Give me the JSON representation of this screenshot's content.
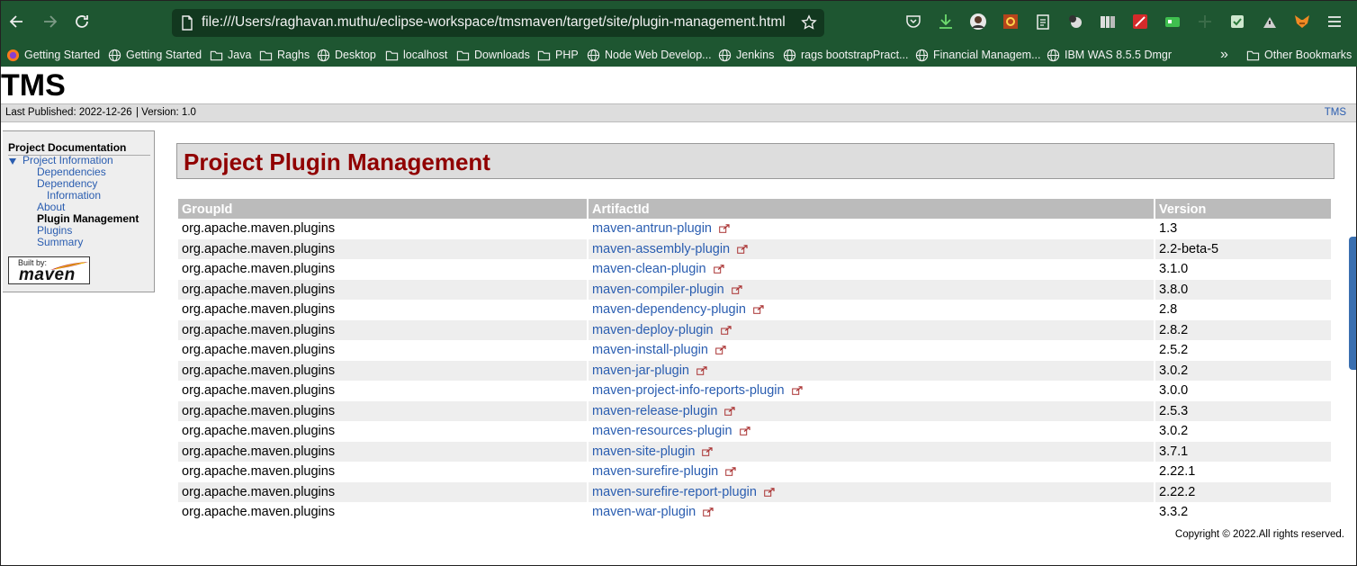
{
  "browser": {
    "url": "file:///Users/raghavan.muthu/eclipse-workspace/tmsmaven/target/site/plugin-management.html",
    "toolbar_icons": [
      "pocket-icon",
      "download-icon",
      "profile-avatar-icon",
      "extension-settings-icon",
      "clipboard-icon",
      "extension-ball-icon",
      "library-icon",
      "extension-red-icon",
      "extension-green-icon",
      "extension-gray-icon",
      "extension-save-icon",
      "extension-tool-icon",
      "metamask-fox-icon",
      "menu-icon"
    ],
    "bookmarks": [
      {
        "label": "Getting Started",
        "icon": "firefox-icon"
      },
      {
        "label": "Getting Started",
        "icon": "globe-icon"
      },
      {
        "label": "Java",
        "icon": "folder-icon"
      },
      {
        "label": "Raghs",
        "icon": "folder-icon"
      },
      {
        "label": "Desktop",
        "icon": "globe-icon"
      },
      {
        "label": "localhost",
        "icon": "folder-icon"
      },
      {
        "label": "Downloads",
        "icon": "folder-icon"
      },
      {
        "label": "PHP",
        "icon": "folder-icon"
      },
      {
        "label": "Node Web Develop...",
        "icon": "globe-icon"
      },
      {
        "label": "Jenkins",
        "icon": "globe-icon"
      },
      {
        "label": "rags bootstrapPract...",
        "icon": "globe-icon"
      },
      {
        "label": "Financial Managem...",
        "icon": "globe-icon"
      },
      {
        "label": "IBM WAS 8.5.5 Dmgr",
        "icon": "globe-icon"
      }
    ],
    "overflow_label": "»",
    "other_bookmarks": "Other Bookmarks",
    "chrome_color": "#1e5631"
  },
  "site": {
    "title": "TMS",
    "last_published": "Last Published: 2022-12-26",
    "version": "| Version: 1.0",
    "right_link": "TMS"
  },
  "nav": {
    "heading": "Project Documentation",
    "group": "Project Information",
    "items": [
      "Dependencies",
      "Dependency",
      "Information",
      "About",
      "Plugin Management",
      "Plugins",
      "Summary"
    ],
    "current": "Plugin Management",
    "built_by": "Built by:",
    "maven": "maven"
  },
  "content": {
    "title": "Project Plugin Management",
    "title_color": "#900000",
    "link_color": "#2a5db0",
    "columns": [
      "GroupId",
      "ArtifactId",
      "Version"
    ],
    "rows": [
      {
        "group": "org.apache.maven.plugins",
        "artifact": "maven-antrun-plugin",
        "version": "1.3"
      },
      {
        "group": "org.apache.maven.plugins",
        "artifact": "maven-assembly-plugin",
        "version": "2.2-beta-5"
      },
      {
        "group": "org.apache.maven.plugins",
        "artifact": "maven-clean-plugin",
        "version": "3.1.0"
      },
      {
        "group": "org.apache.maven.plugins",
        "artifact": "maven-compiler-plugin",
        "version": "3.8.0"
      },
      {
        "group": "org.apache.maven.plugins",
        "artifact": "maven-dependency-plugin",
        "version": "2.8"
      },
      {
        "group": "org.apache.maven.plugins",
        "artifact": "maven-deploy-plugin",
        "version": "2.8.2"
      },
      {
        "group": "org.apache.maven.plugins",
        "artifact": "maven-install-plugin",
        "version": "2.5.2"
      },
      {
        "group": "org.apache.maven.plugins",
        "artifact": "maven-jar-plugin",
        "version": "3.0.2"
      },
      {
        "group": "org.apache.maven.plugins",
        "artifact": "maven-project-info-reports-plugin",
        "version": "3.0.0"
      },
      {
        "group": "org.apache.maven.plugins",
        "artifact": "maven-release-plugin",
        "version": "2.5.3"
      },
      {
        "group": "org.apache.maven.plugins",
        "artifact": "maven-resources-plugin",
        "version": "3.0.2"
      },
      {
        "group": "org.apache.maven.plugins",
        "artifact": "maven-site-plugin",
        "version": "3.7.1"
      },
      {
        "group": "org.apache.maven.plugins",
        "artifact": "maven-surefire-plugin",
        "version": "2.22.1"
      },
      {
        "group": "org.apache.maven.plugins",
        "artifact": "maven-surefire-report-plugin",
        "version": "2.22.2"
      },
      {
        "group": "org.apache.maven.plugins",
        "artifact": "maven-war-plugin",
        "version": "3.3.2"
      }
    ]
  },
  "footer": {
    "copyright": "Copyright © 2022.All rights reserved."
  }
}
